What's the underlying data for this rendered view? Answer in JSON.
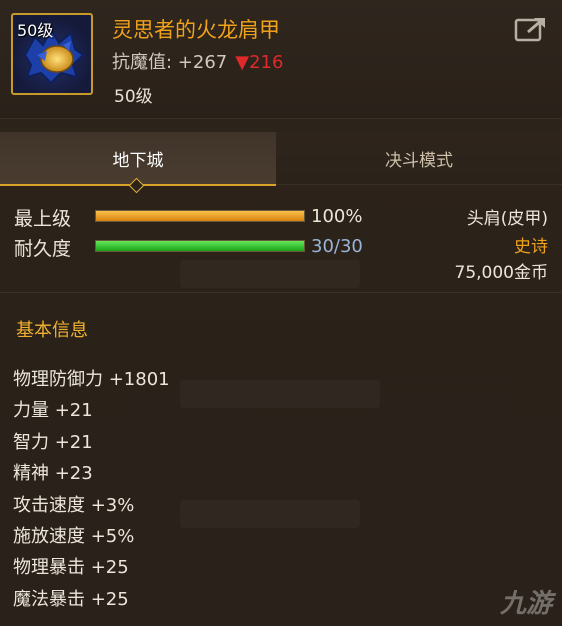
{
  "item": {
    "level_badge": "50级",
    "name": "灵思者的火龙肩甲",
    "resist_label": "抗魔值: +267",
    "resist_change": "▼216",
    "required_level": "50级"
  },
  "tabs": {
    "dungeon": "地下城",
    "pvp": "决斗模式"
  },
  "bars": {
    "top_level": {
      "label": "最上级",
      "value_text": "100%",
      "fraction": 1.0
    },
    "durability": {
      "label": "耐久度",
      "value_text": "30/30",
      "fraction": 1.0
    }
  },
  "info": {
    "slot": "头肩(皮甲)",
    "rarity": "史诗",
    "price": "75,000金币"
  },
  "section": {
    "title": "基本信息"
  },
  "stats": [
    "物理防御力 +1801",
    "力量 +21",
    "智力 +21",
    "精神 +23",
    "攻击速度 +3%",
    "施放速度 +5%",
    "物理暴击 +25",
    "魔法暴击 +25"
  ],
  "watermark": "九游",
  "colors": {
    "item_name": "#f0a21a",
    "resist_down": "#e0292b",
    "rarity_epic": "#f0a21a",
    "section_title": "#f0b030",
    "durability_text": "#9ab4d8",
    "tab_accent": "#d9a32a"
  }
}
